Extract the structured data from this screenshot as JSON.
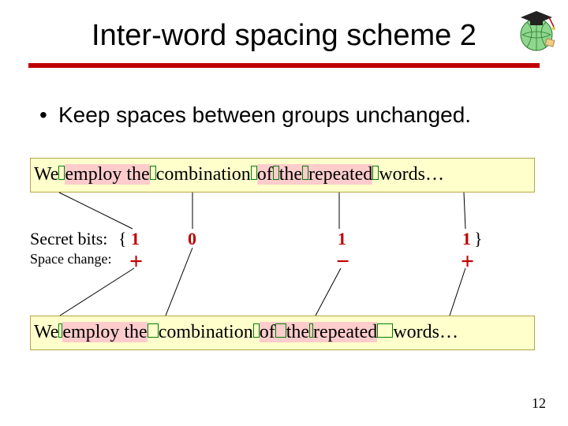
{
  "title": "Inter-word spacing scheme 2",
  "bullet": "Keep spaces between groups unchanged.",
  "example_line1": {
    "w0": "We",
    "w1": "employ",
    "w2": "the",
    "w3": "combination",
    "w4": "of",
    "w5": "the",
    "w6": "repeated",
    "w7": "words…"
  },
  "example_line2": {
    "w0": "We",
    "w1": "employ",
    "w2": "the",
    "w3": "combination",
    "w4": "of",
    "w5": "the",
    "w6": "repeated",
    "w7": "words…"
  },
  "labels": {
    "secret": "Secret bits:",
    "change": "Space change:",
    "brace_open": "{",
    "brace_close": "}"
  },
  "bits": [
    "1",
    "0",
    "1",
    "1"
  ],
  "signs": [
    "+",
    "",
    "−",
    "+"
  ],
  "pagenum": "12"
}
